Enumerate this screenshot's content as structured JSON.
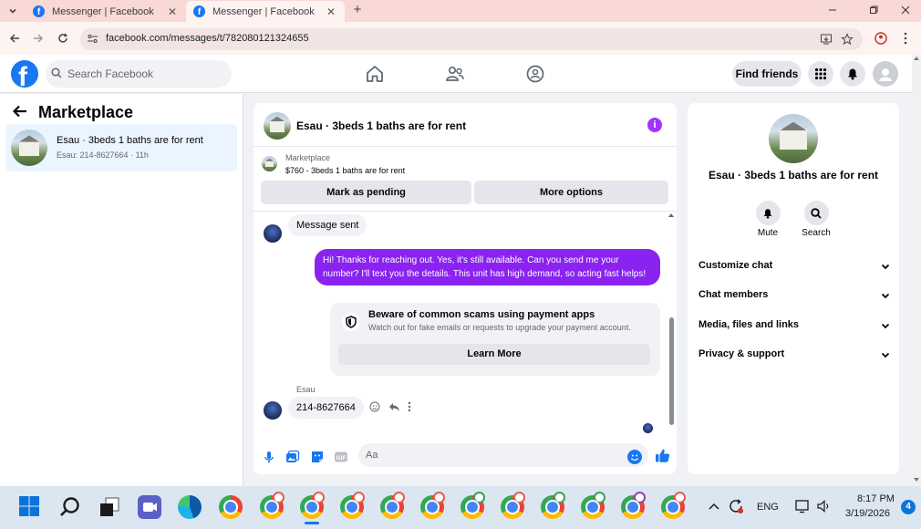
{
  "browser": {
    "tabs": [
      {
        "title": "Messenger | Facebook",
        "active": false
      },
      {
        "title": "Messenger | Facebook",
        "active": true
      }
    ],
    "url": "facebook.com/messages/t/782080121324655"
  },
  "fb_header": {
    "search_placeholder": "Search Facebook",
    "find_friends_label": "Find friends"
  },
  "left_panel": {
    "title": "Marketplace",
    "conversation": {
      "title": "Esau · 3beds 1 baths are for rent",
      "subtitle": "Esau: 214-8627664 · 11h"
    }
  },
  "chat": {
    "header_title": "Esau · 3beds 1 baths are for rent",
    "listing_label": "Marketplace",
    "listing_price": "$760 - 3beds 1 baths are for rent",
    "mark_pending_label": "Mark as pending",
    "more_options_label": "More options",
    "messages": {
      "sent_notice": "Message sent",
      "outgoing": "Hi! Thanks for reaching out. Yes, it's still available. Can you send me your number? I'll text you the details. This unit has high demand, so acting fast helps!",
      "scam_title": "Beware of common scams using payment apps",
      "scam_subtitle": "Watch out for fake emails or requests to upgrade your payment account.",
      "learn_more_label": "Learn More",
      "sender_name": "Esau",
      "phone_message": "214-8627664"
    },
    "composer_placeholder": "Aa"
  },
  "right_panel": {
    "name": "Esau · 3beds 1 baths are for rent",
    "mute_label": "Mute",
    "search_label": "Search",
    "items": [
      "Customize chat",
      "Chat members",
      "Media, files and links",
      "Privacy & support"
    ]
  },
  "taskbar": {
    "language": "ENG",
    "time": "8:17 PM",
    "date": "3/19/2026",
    "notification_count": "4"
  },
  "colors": {
    "fb_blue": "#1877f2",
    "outgoing_bubble": "#8a22f0",
    "tab_bar": "#f8d9d5"
  }
}
